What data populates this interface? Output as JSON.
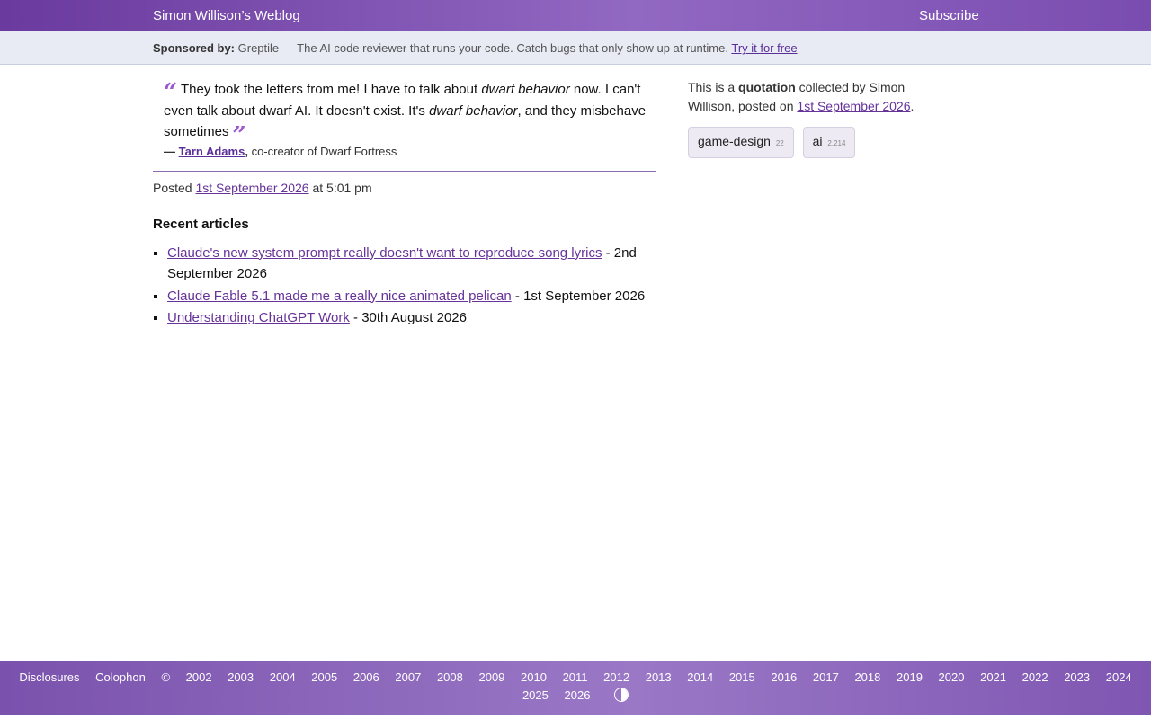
{
  "header": {
    "site_title": "Simon Willison’s Weblog",
    "subscribe": "Subscribe"
  },
  "sponsor": {
    "label": "Sponsored by:",
    "text": "Greptile — The AI code reviewer that runs your code. Catch bugs that only show up at runtime.",
    "link": "Try it for free"
  },
  "quote": {
    "part1": "They took the letters from me! I have to talk about ",
    "em1": "dwarf behavior",
    "part2": " now. I can't even talk about dwarf AI. It doesn't exist. It's ",
    "em2": "dwarf behavior",
    "part3": ", and they misbehave sometimes",
    "author": "Tarn Adams",
    "author_role": "co-creator of Dwarf Fortress"
  },
  "posted": {
    "prefix": "Posted",
    "date": "1st September 2026",
    "time": "at 5:01 pm"
  },
  "recent": {
    "heading": "Recent articles",
    "items": [
      {
        "title": "Claude's new system prompt really doesn't want to reproduce song lyrics",
        "date": "- 2nd September 2026"
      },
      {
        "title": "Claude Fable 5.1 made me a really nice animated pelican",
        "date": "- 1st September 2026"
      },
      {
        "title": "Understanding ChatGPT Work",
        "date": "- 30th August 2026"
      }
    ]
  },
  "sidebar": {
    "intro_prefix": "This is a",
    "type": "quotation",
    "intro_mid": "collected by Simon Willison, posted on",
    "date": "1st September 2026",
    "tags": [
      {
        "name": "game-design",
        "count": "22"
      },
      {
        "name": "ai",
        "count": "2,214"
      }
    ]
  },
  "footer": {
    "disclosures": "Disclosures",
    "colophon": "Colophon",
    "copyright": "©",
    "years": [
      "2002",
      "2003",
      "2004",
      "2005",
      "2006",
      "2007",
      "2008",
      "2009",
      "2010",
      "2011",
      "2012",
      "2013",
      "2014",
      "2015",
      "2016",
      "2017",
      "2018",
      "2019",
      "2020",
      "2021",
      "2022",
      "2023",
      "2024",
      "2025",
      "2026"
    ]
  }
}
